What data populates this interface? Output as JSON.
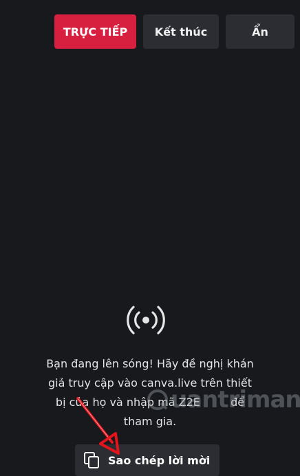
{
  "toolbar": {
    "live_label": "TRỰC TIẾP",
    "end_label": "Kết thúc",
    "hide_label": "Ẩn"
  },
  "main": {
    "message_line1": "Bạn đang lên sóng! Hãy đề nghị khán",
    "message_line2": "giả truy cập vào canva.live trên thiết",
    "message_line3": "bị của họ và nhập mã Z2E",
    "message_line3_end": "để",
    "message_line4": "tham gia.",
    "copy_invite_label": "Sao chép lời mời"
  },
  "watermark": {
    "text": "uantrimang"
  },
  "colors": {
    "background": "#17191d",
    "live_button": "#d71f3f",
    "secondary_button": "#2b2d33",
    "annotation_arrow": "#e3141c"
  },
  "icons": {
    "broadcast": "broadcast-icon",
    "copy": "copy-icon",
    "arrow": "annotation-arrow"
  }
}
